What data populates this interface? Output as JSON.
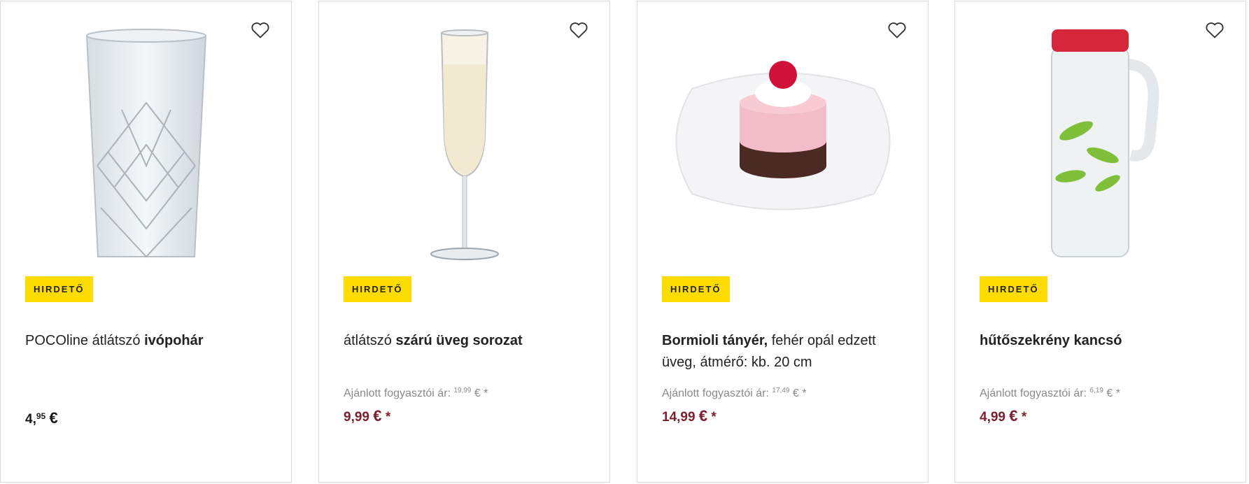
{
  "products": [
    {
      "title_pre": "POCOline átlátszó ",
      "title_bold": "ivópohár",
      "title_post": "",
      "badge": "HIRDETŐ",
      "price_int": "4,",
      "price_dec": "95",
      "price_curr": "€",
      "price_mark": ""
    },
    {
      "title_pre": "átlátszó ",
      "title_bold": "szárú üveg sorozat",
      "title_post": "",
      "badge": "HIRDETŐ",
      "rrp_label": "Ajánlott fogyasztói ár:",
      "rrp_value": "19,99",
      "rrp_suffix": "€ *",
      "price_int": "9,",
      "price_dec": "99",
      "price_curr": "€",
      "price_mark": "*"
    },
    {
      "title_pre": "",
      "title_bold": "Bormioli tányér,",
      "title_post": " fehér opál edzett üveg, átmérő: kb. 20 cm",
      "badge": "HIRDETŐ",
      "rrp_label": "Ajánlott fogyasztói ár:",
      "rrp_value": "17,49",
      "rrp_suffix": "€ *",
      "price_int": "14,",
      "price_dec": "99",
      "price_curr": "€",
      "price_mark": "*"
    },
    {
      "title_pre": "",
      "title_bold": "hűtőszekrény kancsó",
      "title_post": "",
      "badge": "HIRDETŐ",
      "rrp_label": "Ajánlott fogyasztói ár:",
      "rrp_value": "6,19",
      "rrp_suffix": "€ *",
      "price_int": "4,",
      "price_dec": "99",
      "price_curr": "€",
      "price_mark": "*"
    }
  ],
  "colors": {
    "badge": "#ffdc00",
    "sale_price": "#7a1f2e",
    "rrp": "#8a8a8a"
  }
}
